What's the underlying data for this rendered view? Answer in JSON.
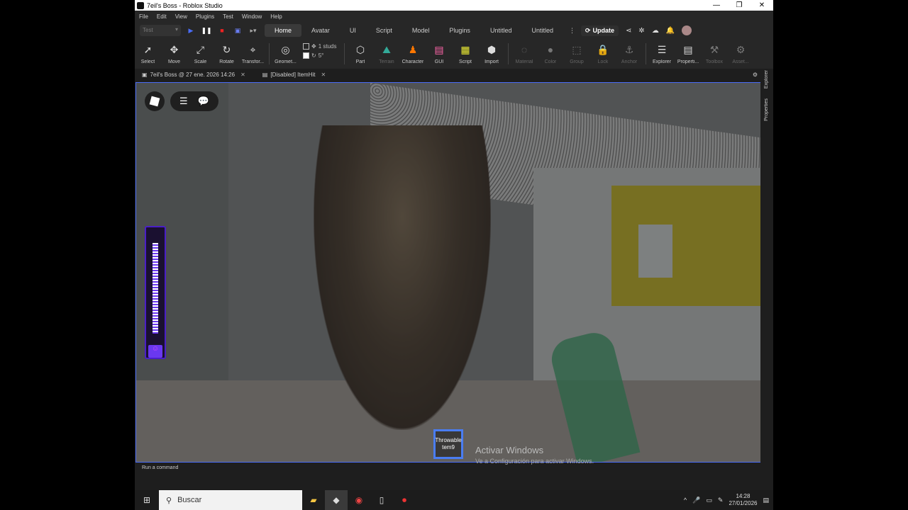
{
  "window": {
    "title": "7eil's Boss - Roblox Studio",
    "minimize": "—",
    "maximize": "❐",
    "close": "✕"
  },
  "menu": [
    "File",
    "Edit",
    "View",
    "Plugins",
    "Test",
    "Window",
    "Help"
  ],
  "tabrow": {
    "test_selector": "Test",
    "tabs": [
      "Home",
      "Avatar",
      "UI",
      "Script",
      "Model",
      "Plugins",
      "Untitled",
      "Untitled"
    ],
    "active_tab": "Home",
    "update_label": "Update"
  },
  "ribbon": {
    "tools": {
      "select": "Select",
      "move": "Move",
      "scale": "Scale",
      "rotate": "Rotate",
      "transform": "Transfor...",
      "geometry": "Geomet...",
      "part": "Part",
      "terrain": "Terrain",
      "character": "Character",
      "gui": "GUI",
      "script": "Script",
      "import": "Import",
      "material": "Material",
      "color": "Color",
      "group": "Group",
      "lock": "Lock",
      "anchor": "Anchor",
      "explorer": "Explorer",
      "properties": "Properti...",
      "toolbox": "Toolbox",
      "assets": "Asset..."
    },
    "snap_move": "1 studs",
    "snap_rotate": "5°"
  },
  "doctabs": [
    "7eil's Boss @ 27 ene. 2026 14:26",
    "[Disabled] ItemHit"
  ],
  "side_panel": [
    "Explorer",
    "Properties"
  ],
  "viewport": {
    "hotbar_item": "Throwable tem9",
    "meter_level": 0.85
  },
  "watermark": {
    "line1": "Activar Windows",
    "line2": "Ve a Configuración para activar Windows."
  },
  "command_bar": {
    "placeholder": "Run a command"
  },
  "taskbar": {
    "search_placeholder": "Buscar",
    "time": "14:28",
    "date": "27/01/2026"
  }
}
